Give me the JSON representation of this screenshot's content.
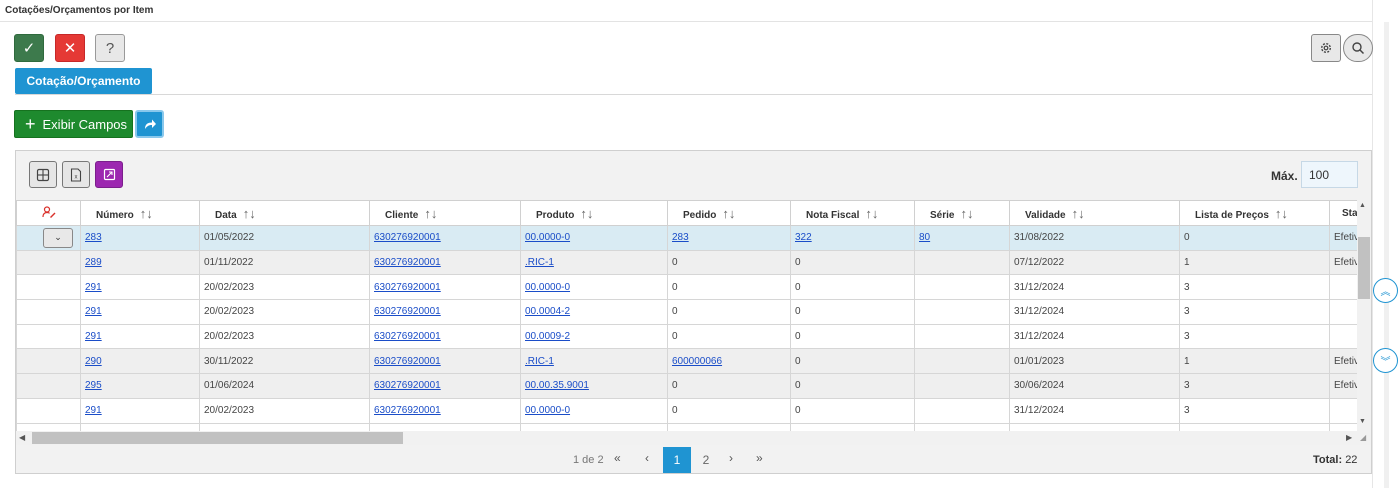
{
  "window": {
    "title": "Cotações/Orçamentos por Item"
  },
  "toolbar": {
    "confirm_icon": "check-icon",
    "cancel_icon": "close-icon",
    "help_label": "?",
    "settings_icon": "gear-icon",
    "search_icon": "search-icon"
  },
  "tabs": [
    {
      "label": "Cotação/Orçamento",
      "active": true
    }
  ],
  "actions": {
    "exibir_campos_label": "Exibir Campos",
    "share_icon": "share-arrow-icon"
  },
  "grid": {
    "max_label": "Máx.",
    "max_value": "100",
    "columns": [
      "Número",
      "Data",
      "Cliente",
      "Produto",
      "Pedido",
      "Nota Fiscal",
      "Série",
      "Validade",
      "Lista de Preços",
      "Sta"
    ],
    "rows": [
      {
        "numero": "283",
        "data": "01/05/2022",
        "cliente": "630276920001",
        "produto": "00.0000-0",
        "pedido": "283",
        "nota_fiscal": "322",
        "serie": "80",
        "validade": "31/08/2022",
        "lista": "0",
        "status": "Efetiv"
      },
      {
        "numero": "289",
        "data": "01/11/2022",
        "cliente": "630276920001",
        "produto": ".RIC-1",
        "pedido": "0",
        "nota_fiscal": "0",
        "serie": "",
        "validade": "07/12/2022",
        "lista": "1",
        "status": "Efetiv"
      },
      {
        "numero": "291",
        "data": "20/02/2023",
        "cliente": "630276920001",
        "produto": "00.0000-0",
        "pedido": "0",
        "nota_fiscal": "0",
        "serie": "",
        "validade": "31/12/2024",
        "lista": "3",
        "status": ""
      },
      {
        "numero": "291",
        "data": "20/02/2023",
        "cliente": "630276920001",
        "produto": "00.0004-2",
        "pedido": "0",
        "nota_fiscal": "0",
        "serie": "",
        "validade": "31/12/2024",
        "lista": "3",
        "status": ""
      },
      {
        "numero": "291",
        "data": "20/02/2023",
        "cliente": "630276920001",
        "produto": "00.0009-2",
        "pedido": "0",
        "nota_fiscal": "0",
        "serie": "",
        "validade": "31/12/2024",
        "lista": "3",
        "status": ""
      },
      {
        "numero": "290",
        "data": "30/11/2022",
        "cliente": "630276920001",
        "produto": ".RIC-1",
        "pedido": "600000066",
        "nota_fiscal": "0",
        "serie": "",
        "validade": "01/01/2023",
        "lista": "1",
        "status": "Efetiv"
      },
      {
        "numero": "295",
        "data": "01/06/2024",
        "cliente": "630276920001",
        "produto": "00.00.35.9001",
        "pedido": "0",
        "nota_fiscal": "0",
        "serie": "",
        "validade": "30/06/2024",
        "lista": "3",
        "status": "Efetiv"
      },
      {
        "numero": "291",
        "data": "20/02/2023",
        "cliente": "630276920001",
        "produto": "00.0000-0",
        "pedido": "0",
        "nota_fiscal": "0",
        "serie": "",
        "validade": "31/12/2024",
        "lista": "3",
        "status": ""
      },
      {
        "numero": "",
        "data": "",
        "cliente": "",
        "produto": "",
        "pedido": "",
        "nota_fiscal": "",
        "serie": "",
        "validade": "",
        "lista": "",
        "status": ""
      }
    ]
  },
  "pagination": {
    "info": "1 de 2",
    "first": "«",
    "prev": "‹",
    "current": "1",
    "page2": "2",
    "next": "›",
    "last": "»",
    "total_label": "Total:",
    "total_value": "22"
  },
  "colors": {
    "accent": "#1f94d2",
    "ok": "#3d7a4c",
    "cancel": "#e53935",
    "exibir": "#1e8a2e",
    "purple": "#9c27b0"
  }
}
